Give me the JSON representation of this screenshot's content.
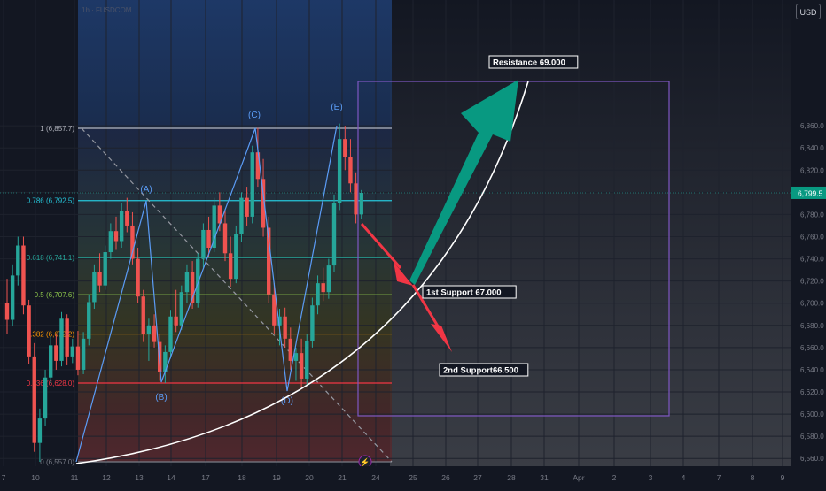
{
  "currency": "USD",
  "symbol_header": "1h · FUSDCOM",
  "chart_data": {
    "type": "candlestick",
    "title": "",
    "price_axis": {
      "range": [
        6550,
        6920
      ],
      "ticks": [
        6860,
        6840,
        6820,
        6800,
        6780,
        6760,
        6740,
        6720,
        6700,
        6680,
        6660,
        6640,
        6620,
        6600,
        6580,
        6560
      ],
      "tick_labels": [
        "6,860.0",
        "6,840.0",
        "6,820.0",
        "6,800.0",
        "6,780.0",
        "6,760.0",
        "6,740.0",
        "6,720.0",
        "6,700.0",
        "6,680.0",
        "6,660.0",
        "6,640.0",
        "6,620.0",
        "6,600.0",
        "6,580.0",
        "6,560.0"
      ],
      "current_price": 6799.5,
      "current_price_label": "6,799.5"
    },
    "time_axis": {
      "labels": [
        "7",
        "10",
        "11",
        "12",
        "13",
        "14",
        "17",
        "18",
        "19",
        "20",
        "21",
        "24",
        "25",
        "26",
        "27",
        "28",
        "31",
        "Apr",
        "2",
        "3",
        "4",
        "7",
        "8",
        "9"
      ]
    },
    "fibonacci": [
      {
        "ratio": "1",
        "price": 6857.7,
        "label": "1 (6,857.7)",
        "color": "#b2b5be"
      },
      {
        "ratio": "0.786",
        "price": 6792.5,
        "label": "0.786 (6,792.5)",
        "color": "#26c6da"
      },
      {
        "ratio": "0.618",
        "price": 6741.1,
        "label": "0.618 (6,741.1)",
        "color": "#26a69a"
      },
      {
        "ratio": "0.5",
        "price": 6707.6,
        "label": "0.5 (6,707.6)",
        "color": "#8bc34a"
      },
      {
        "ratio": "0.382",
        "price": 6672.2,
        "label": "0.382 (6,672.2)",
        "color": "#ff9800"
      },
      {
        "ratio": "0.236",
        "price": 6628.0,
        "label": "0.236 (6,628.0)",
        "color": "#f23645"
      },
      {
        "ratio": "0",
        "price": 6557.0,
        "label": "0 (6,557.0)",
        "color": "#787b86"
      }
    ],
    "wave_labels": [
      {
        "label": "(A)",
        "time_index": 24,
        "price": 6794
      },
      {
        "label": "(B)",
        "time_index": 30,
        "price": 6628
      },
      {
        "label": "(C)",
        "time_index": 47,
        "price": 6857
      },
      {
        "label": "(D)",
        "time_index": 55,
        "price": 6624
      },
      {
        "label": "(E)",
        "time_index": 62,
        "price": 6860
      }
    ],
    "annotations": {
      "resistance": {
        "label": "Resistance 69.000",
        "price": 6865
      },
      "support_1": {
        "label": "1st Support 67.000",
        "price": 6722
      },
      "support_2": {
        "label": "2nd Support66.500",
        "price": 6633
      }
    },
    "candles": [
      {
        "o": 6700,
        "h": 6722,
        "l": 6672,
        "c": 6685
      },
      {
        "o": 6685,
        "h": 6735,
        "l": 6679,
        "c": 6725
      },
      {
        "o": 6725,
        "h": 6760,
        "l": 6716,
        "c": 6752
      },
      {
        "o": 6752,
        "h": 6760,
        "l": 6690,
        "c": 6698
      },
      {
        "o": 6698,
        "h": 6703,
        "l": 6645,
        "c": 6652
      },
      {
        "o": 6652,
        "h": 6664,
        "l": 6566,
        "c": 6574
      },
      {
        "o": 6574,
        "h": 6605,
        "l": 6557,
        "c": 6596
      },
      {
        "o": 6596,
        "h": 6640,
        "l": 6589,
        "c": 6633
      },
      {
        "o": 6633,
        "h": 6670,
        "l": 6628,
        "c": 6662
      },
      {
        "o": 6662,
        "h": 6672,
        "l": 6640,
        "c": 6648
      },
      {
        "o": 6648,
        "h": 6692,
        "l": 6643,
        "c": 6686
      },
      {
        "o": 6686,
        "h": 6690,
        "l": 6644,
        "c": 6652
      },
      {
        "o": 6652,
        "h": 6668,
        "l": 6646,
        "c": 6661
      },
      {
        "o": 6661,
        "h": 6675,
        "l": 6635,
        "c": 6640
      },
      {
        "o": 6640,
        "h": 6674,
        "l": 6636,
        "c": 6668
      },
      {
        "o": 6668,
        "h": 6708,
        "l": 6662,
        "c": 6701
      },
      {
        "o": 6701,
        "h": 6735,
        "l": 6695,
        "c": 6728
      },
      {
        "o": 6728,
        "h": 6745,
        "l": 6710,
        "c": 6716
      },
      {
        "o": 6716,
        "h": 6752,
        "l": 6712,
        "c": 6746
      },
      {
        "o": 6746,
        "h": 6772,
        "l": 6740,
        "c": 6765
      },
      {
        "o": 6765,
        "h": 6778,
        "l": 6748,
        "c": 6756
      },
      {
        "o": 6756,
        "h": 6790,
        "l": 6750,
        "c": 6783
      },
      {
        "o": 6783,
        "h": 6795,
        "l": 6764,
        "c": 6770
      },
      {
        "o": 6770,
        "h": 6782,
        "l": 6735,
        "c": 6740
      },
      {
        "o": 6740,
        "h": 6750,
        "l": 6700,
        "c": 6706
      },
      {
        "o": 6706,
        "h": 6712,
        "l": 6665,
        "c": 6672
      },
      {
        "o": 6672,
        "h": 6686,
        "l": 6648,
        "c": 6680
      },
      {
        "o": 6680,
        "h": 6690,
        "l": 6660,
        "c": 6665
      },
      {
        "o": 6665,
        "h": 6672,
        "l": 6630,
        "c": 6638
      },
      {
        "o": 6638,
        "h": 6662,
        "l": 6628,
        "c": 6656
      },
      {
        "o": 6656,
        "h": 6694,
        "l": 6650,
        "c": 6688
      },
      {
        "o": 6688,
        "h": 6712,
        "l": 6674,
        "c": 6680
      },
      {
        "o": 6680,
        "h": 6716,
        "l": 6676,
        "c": 6710
      },
      {
        "o": 6710,
        "h": 6735,
        "l": 6700,
        "c": 6728
      },
      {
        "o": 6728,
        "h": 6738,
        "l": 6695,
        "c": 6700
      },
      {
        "o": 6700,
        "h": 6745,
        "l": 6696,
        "c": 6740
      },
      {
        "o": 6740,
        "h": 6772,
        "l": 6732,
        "c": 6766
      },
      {
        "o": 6766,
        "h": 6778,
        "l": 6742,
        "c": 6750
      },
      {
        "o": 6750,
        "h": 6795,
        "l": 6746,
        "c": 6788
      },
      {
        "o": 6788,
        "h": 6800,
        "l": 6765,
        "c": 6772
      },
      {
        "o": 6772,
        "h": 6785,
        "l": 6738,
        "c": 6745
      },
      {
        "o": 6745,
        "h": 6760,
        "l": 6715,
        "c": 6722
      },
      {
        "o": 6722,
        "h": 6770,
        "l": 6718,
        "c": 6762
      },
      {
        "o": 6762,
        "h": 6800,
        "l": 6755,
        "c": 6795
      },
      {
        "o": 6795,
        "h": 6805,
        "l": 6770,
        "c": 6778
      },
      {
        "o": 6778,
        "h": 6842,
        "l": 6772,
        "c": 6836
      },
      {
        "o": 6836,
        "h": 6858,
        "l": 6805,
        "c": 6812
      },
      {
        "o": 6812,
        "h": 6830,
        "l": 6760,
        "c": 6768
      },
      {
        "o": 6768,
        "h": 6778,
        "l": 6700,
        "c": 6708
      },
      {
        "o": 6708,
        "h": 6718,
        "l": 6672,
        "c": 6680
      },
      {
        "o": 6680,
        "h": 6695,
        "l": 6662,
        "c": 6688
      },
      {
        "o": 6688,
        "h": 6696,
        "l": 6660,
        "c": 6668
      },
      {
        "o": 6668,
        "h": 6678,
        "l": 6640,
        "c": 6648
      },
      {
        "o": 6648,
        "h": 6660,
        "l": 6630,
        "c": 6655
      },
      {
        "o": 6655,
        "h": 6668,
        "l": 6624,
        "c": 6632
      },
      {
        "o": 6632,
        "h": 6672,
        "l": 6626,
        "c": 6666
      },
      {
        "o": 6666,
        "h": 6705,
        "l": 6660,
        "c": 6698
      },
      {
        "o": 6698,
        "h": 6725,
        "l": 6690,
        "c": 6718
      },
      {
        "o": 6718,
        "h": 6732,
        "l": 6702,
        "c": 6710
      },
      {
        "o": 6710,
        "h": 6740,
        "l": 6704,
        "c": 6734
      },
      {
        "o": 6734,
        "h": 6798,
        "l": 6728,
        "c": 6790
      },
      {
        "o": 6790,
        "h": 6862,
        "l": 6784,
        "c": 6848
      },
      {
        "o": 6848,
        "h": 6860,
        "l": 6820,
        "c": 6832
      },
      {
        "o": 6832,
        "h": 6848,
        "l": 6800,
        "c": 6808
      },
      {
        "o": 6808,
        "h": 6818,
        "l": 6772,
        "c": 6780
      },
      {
        "o": 6780,
        "h": 6802,
        "l": 6776,
        "c": 6799.5
      }
    ]
  }
}
